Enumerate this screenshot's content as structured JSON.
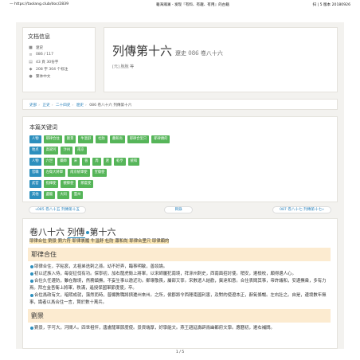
{
  "header": {
    "left": "— https://taolang.club/doc/2839",
    "center": "籍海瀚澜 - 发现『有料、有趣、有用』的古籍",
    "right": "扫 | 5 版本 20180926"
  },
  "docinfo": {
    "title": "文档信息",
    "rows": [
      "遼史",
      "086 / 117",
      "43 頁 30份字",
      "208 字 304 个标注",
      "繁体中文"
    ]
  },
  "title": {
    "main": "列傳第十六",
    "sub": "遼史 086 卷八十六",
    "author": "[元] 脫脫 等"
  },
  "breadcrumb": [
    "史部",
    "正史",
    "二十四史",
    "遼史",
    "086 卷八十六 列傳第十六"
  ],
  "keywords": {
    "title": "本篇关键词",
    "rows": [
      [
        {
          "t": "人物",
          "c": "blue"
        },
        {
          "t": "耶律合住",
          "c": "green"
        },
        {
          "t": "劉景",
          "c": "green"
        },
        {
          "t": "牛溫舒",
          "c": "green"
        },
        {
          "t": "杜防",
          "c": "green"
        },
        {
          "t": "蕭和尚",
          "c": "green"
        },
        {
          "t": "耶律合里只",
          "c": "green"
        },
        {
          "t": "耶律頗的",
          "c": "green"
        }
      ],
      [
        {
          "t": "地点",
          "c": "blue"
        },
        {
          "t": "高梁河",
          "c": "green"
        },
        {
          "t": "汴州",
          "c": "green"
        },
        {
          "t": "南京",
          "c": "green"
        }
      ],
      [
        {
          "t": "人物",
          "c": "blue"
        },
        {
          "t": "六世",
          "c": "green"
        },
        {
          "t": "藥師",
          "c": "green"
        },
        {
          "t": "宋",
          "c": "green"
        },
        {
          "t": "晉",
          "c": "green"
        },
        {
          "t": "周",
          "c": "green"
        },
        {
          "t": "遼",
          "c": "green"
        },
        {
          "t": "乾亨",
          "c": "green"
        },
        {
          "t": "統和",
          "c": "green"
        }
      ],
      [
        {
          "t": "官職",
          "c": "blue"
        },
        {
          "t": "左衛大將軍",
          "c": "green"
        },
        {
          "t": "南京統軍使",
          "c": "green"
        },
        {
          "t": "宣徽使",
          "c": "green"
        }
      ],
      [
        {
          "t": "武官",
          "c": "blue"
        },
        {
          "t": "指揮使",
          "c": "green"
        },
        {
          "t": "觀察使",
          "c": "green"
        },
        {
          "t": "節度使",
          "c": "green"
        }
      ],
      [
        {
          "t": "其他",
          "c": "blue"
        },
        {
          "t": "盧龍",
          "c": "green"
        },
        {
          "t": "大同",
          "c": "green"
        },
        {
          "t": "雲州",
          "c": "green"
        }
      ]
    ]
  },
  "nav": {
    "prev": "«085 卷八十五 列傳第十五",
    "contents": "目錄",
    "next": "087 卷八十七 列傳第十七»"
  },
  "text": {
    "chapter_main": "卷八十六",
    "chapter_name": "列傳",
    "chapter_num": "第十六",
    "list_line": "耶律合住 劉景 劉六符 耶律褭履 牛溫舒 杜防 蕭和尚 耶律合里只 耶律頗的",
    "section1": "耶律合住",
    "p1": "耶律合住，字粘衮，太祖弟迭剌之孫。幼不好弄，臨事明敏，善談論。",
    "p2": "初以近族入侍，每從征伐有功。保寧初，加右龍虎衛上將軍，以宋師屢犯南境，拜涿州刺史，西南面招討使。稍安，遷檢校，頗得邊人心。",
    "p3": "合住久任邊防，雖在敵境，然務鎮撫，不妄生事以邀近功。鄰壤敬畏，屬部又寧。宋數遣人結歡，冀達和意。合住表聞其事，帝許議和，安邊撫衆，多有力焉。拜左金吾衛上將軍，秩滿，遙授保國軍節度使，卒。",
    "p4": "合住爲政有文，暗熙成就，蕩然而時，普顯教職將擠遷州來州。之所，侯郡將令西陲南國利害，及對的使遼本正，辭氣條暢。左右壯之。自是，邊境數年無事，識者以爲合住一言，賢於數十萬兵。",
    "section2": "劉景",
    "p5": "劉景，字可大，河間人。四世祖怦，唐盧龍軍節度使。景資端厚，好學能文。燕王趙延壽辟爲幽都府文學。應曆初，遷右補闕。"
  },
  "pager": "1 / 5"
}
